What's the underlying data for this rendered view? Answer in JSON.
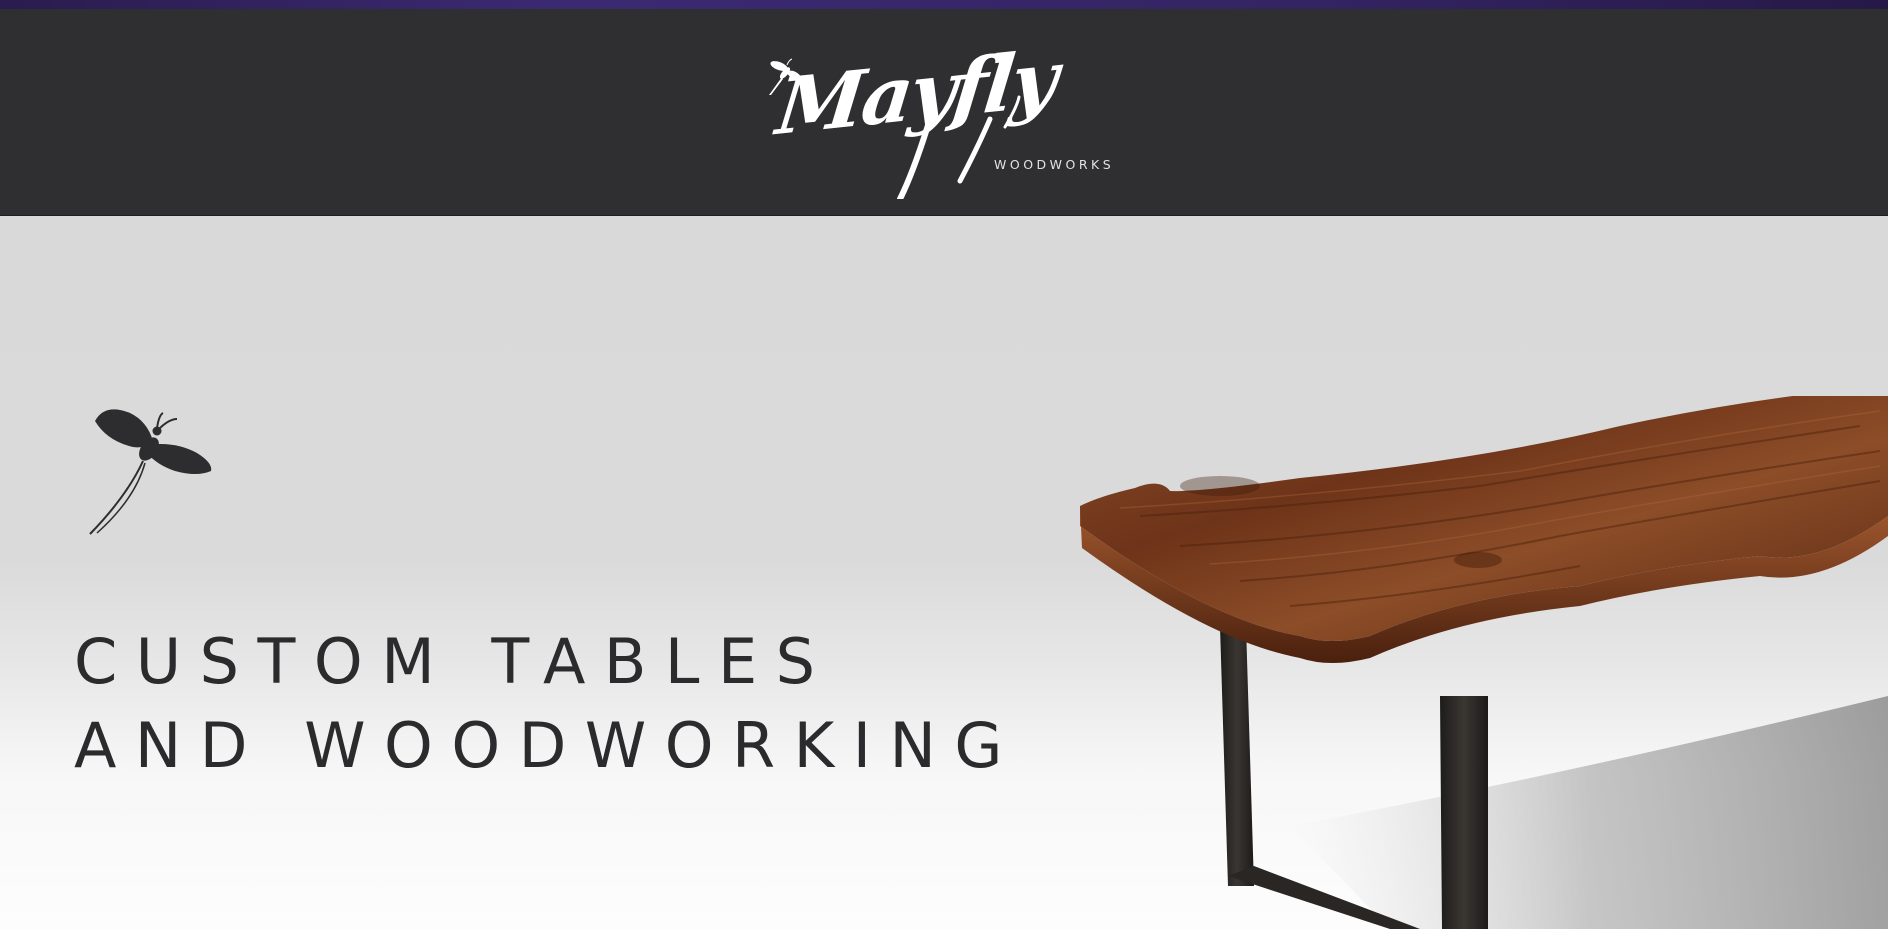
{
  "header": {
    "logo": {
      "script": "Mayfly",
      "subtitle": "WOODWORKS",
      "mini_icon": "mayfly-icon"
    }
  },
  "hero": {
    "icon": "mayfly-icon",
    "headline": {
      "line1": "CUSTOM TABLES",
      "line2": "AND WOODWORKING"
    },
    "image": "live-edge-table-photo"
  },
  "colors": {
    "header_bg": "#2f2f31",
    "top_accent": "#332462",
    "hero_bg": "#dadada",
    "headline_text": "#2b2b2d",
    "wood": "#7a3a1c"
  }
}
